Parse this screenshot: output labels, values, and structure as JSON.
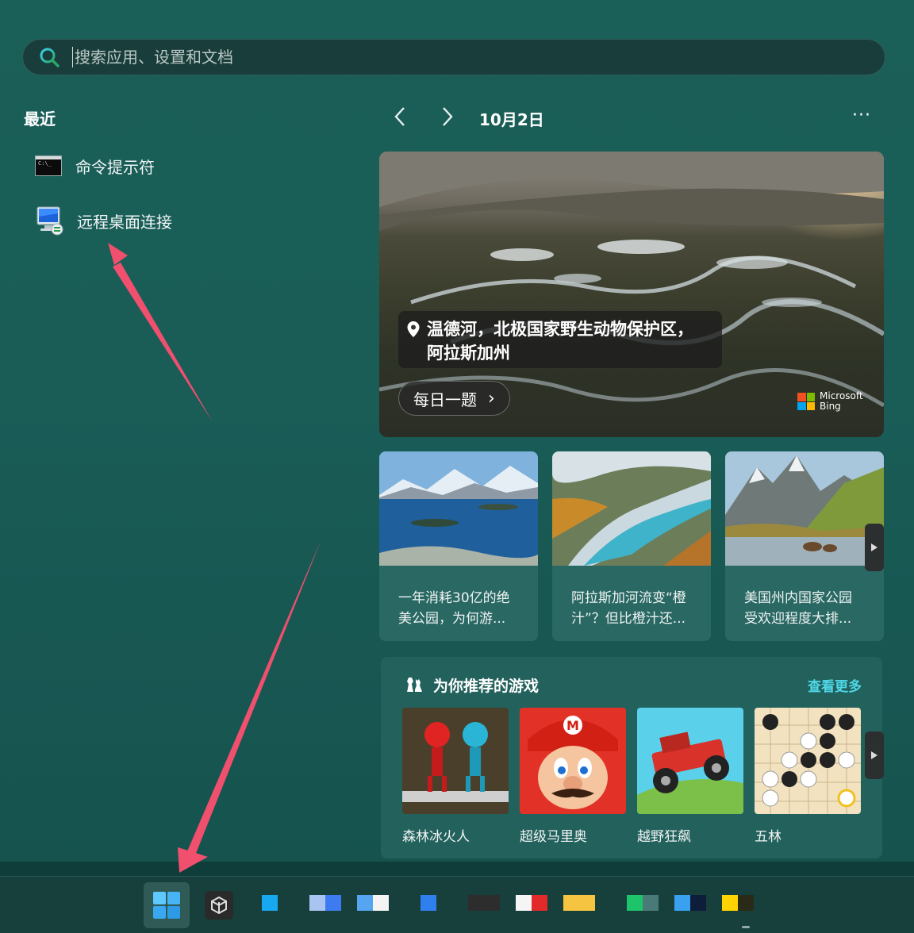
{
  "search": {
    "placeholder": "搜索应用、设置和文档"
  },
  "recent": {
    "title": "最近",
    "items": [
      {
        "label": "命令提示符",
        "icon": "command-prompt-icon"
      },
      {
        "label": "远程桌面连接",
        "icon": "remote-desktop-icon"
      }
    ]
  },
  "feed": {
    "date": "10月2日",
    "prev_icon": "chevron-left-icon",
    "next_icon": "chevron-right-icon",
    "more_label": "···",
    "hero": {
      "location_line1": "温德河，北极国家野生动物保护区，",
      "location_line2": "阿拉斯加州",
      "quiz_label": "每日一题",
      "brand_line1": "Microsoft",
      "brand_line2": "Bing"
    },
    "news": [
      {
        "line1": "一年消耗30亿的绝",
        "line2": "美公园，为何游..."
      },
      {
        "line1": "阿拉斯加河流变“橙",
        "line2": "汁”？但比橙汁还..."
      },
      {
        "line1": "美国州内国家公园",
        "line2": "受欢迎程度大排..."
      }
    ]
  },
  "games": {
    "title": "为你推荐的游戏",
    "see_more": "查看更多",
    "items": [
      {
        "name": "森林冰火人"
      },
      {
        "name": "超级马里奥"
      },
      {
        "name": "越野狂飙"
      },
      {
        "name": "五林"
      }
    ]
  },
  "colors": {
    "accent": "#4fd7e8",
    "annotation_arrow": "#f0506e"
  }
}
